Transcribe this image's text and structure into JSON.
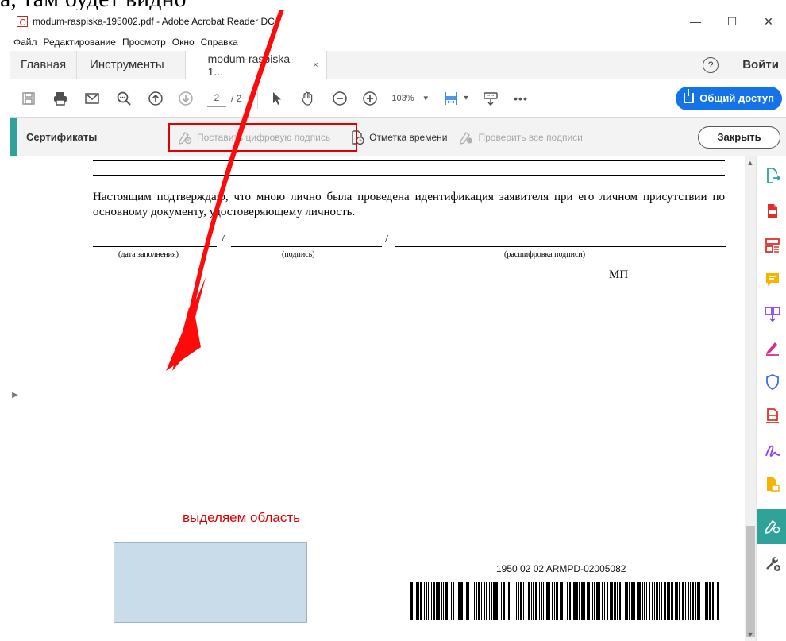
{
  "window": {
    "title": "modum-raspiska-195002.pdf - Adobe Acrobat Reader DC",
    "minimize": "—",
    "maximize": "☐",
    "close": "✕"
  },
  "menu": [
    "Файл",
    "Редактирование",
    "Просмотр",
    "Окно",
    "Справка"
  ],
  "tabs": {
    "home": "Главная",
    "tools": "Инструменты",
    "document": "modum-raspiska-1...",
    "document_close": "×",
    "help": "?",
    "signin": "Войти"
  },
  "toolbar": {
    "page_current": "2",
    "page_total": "/ 2",
    "zoom": "103%",
    "zoom_caret": "▾",
    "more": "•••",
    "share": "Общий доступ"
  },
  "certificates": {
    "title": "Сертификаты",
    "sign": "Поставить цифровую подпись",
    "timestamp": "Отметка времени",
    "validate": "Проверить все подписи",
    "close": "Закрыть"
  },
  "document": {
    "paragraph": "Настоящим подтверждаю, что мною лично была проведена идентификация заявителя при его личном присутствии по основному документу, удостоверяющему личность.",
    "caption_date": "(дата заполнения)",
    "caption_signature": "(подпись)",
    "caption_decode": "(расшифровка подписи)",
    "slash": "/",
    "stamp": "МП",
    "barcode_text": "1950 02 02 ARMPD-02005082"
  },
  "annotation": {
    "label": "выделяем область",
    "color": "#e00000"
  },
  "right_panel_icons": [
    "export-pdf-icon",
    "create-pdf-icon",
    "organize-pages-icon",
    "comment-icon",
    "combine-files-icon",
    "fill-sign-icon",
    "protect-icon",
    "pdf-tools-icon",
    "request-signature-icon",
    "send-review-icon",
    "certificates-icon",
    "more-tools-icon"
  ],
  "colors": {
    "accent_teal": "#2fa39a",
    "share_blue": "#1473e6"
  }
}
